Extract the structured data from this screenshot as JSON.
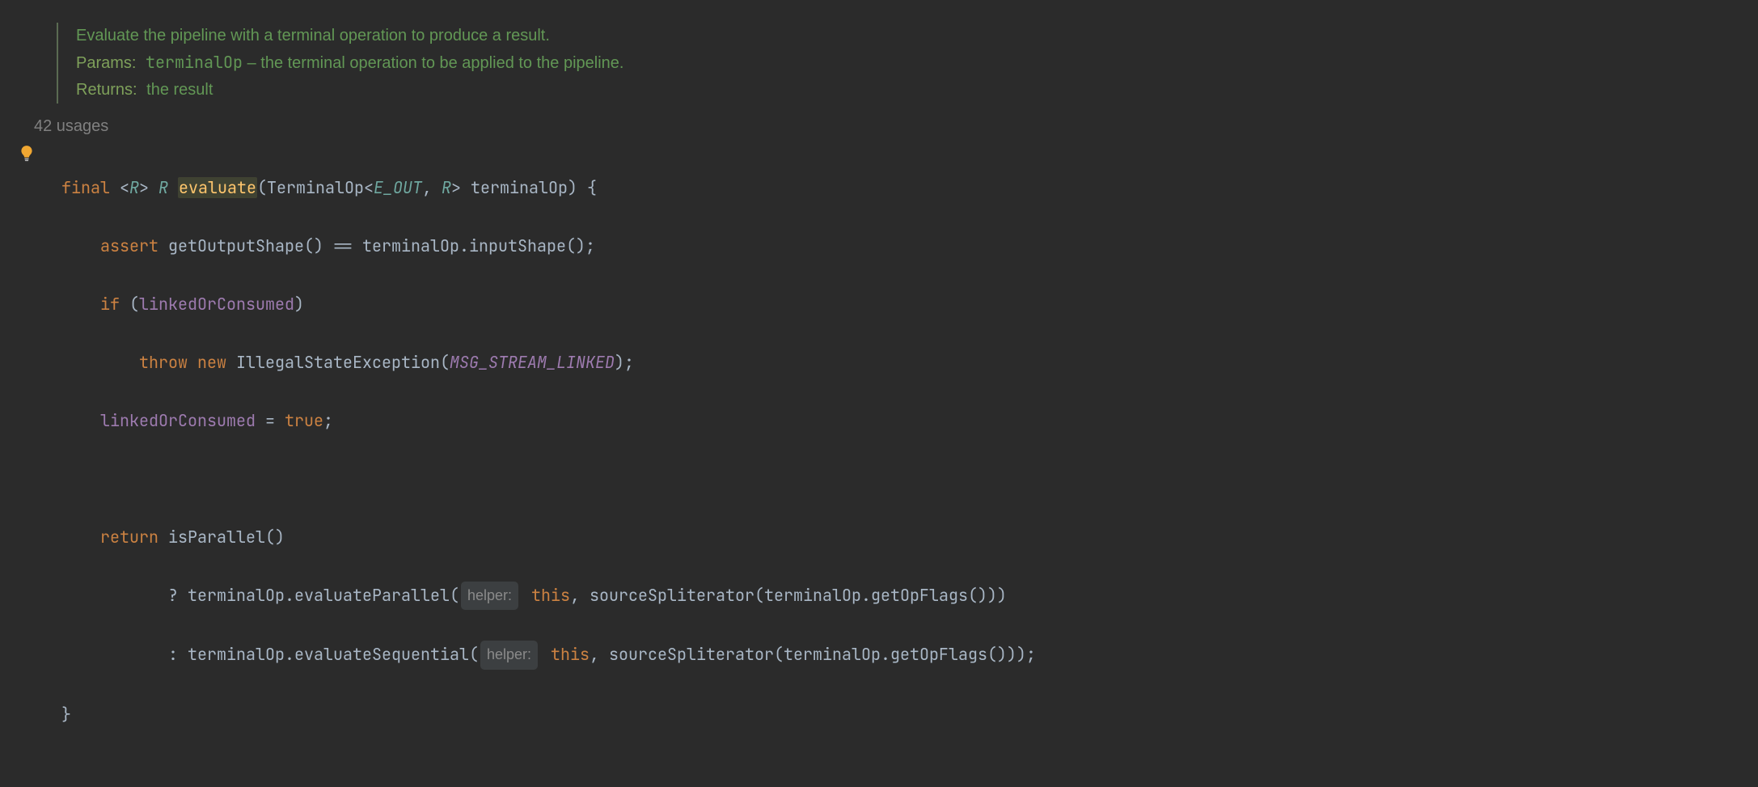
{
  "doc": {
    "summary": "Evaluate the pipeline with a terminal operation to produce a result.",
    "paramsLabel": "Params:",
    "paramName": "terminalOp",
    "paramDesc": " – the terminal operation to be applied to the pipeline.",
    "returnsLabel": "Returns:",
    "returnsDesc": "the result"
  },
  "usages": "42 usages",
  "hints": {
    "helper": "helper:"
  },
  "code": {
    "kw_final": "final",
    "kw_assert": "assert",
    "kw_if": "if",
    "kw_throw": "throw",
    "kw_new": "new",
    "kw_return": "return",
    "kw_true": "true",
    "kw_this1": "this",
    "kw_this2": "this",
    "gen_open": "<",
    "gen_R": "R",
    "gen_close": ">",
    "ret_R": "R",
    "method_evaluate": "evaluate",
    "type_TerminalOp": "TerminalOp",
    "lt": "<",
    "type_E_OUT": "E_OUT",
    "comma1": ", ",
    "type_R2": "R",
    "gt": ">",
    "param_terminalOp": "terminalOp",
    "brace_open": " {",
    "call_getOutputShape": "getOutputShape",
    "eqeq": " == ",
    "call_inputShape": "inputShape",
    "field_linkedOrConsumed": "linkedOrConsumed",
    "type_IllegalStateException": "IllegalStateException",
    "const_MSG": "MSG_STREAM_LINKED",
    "call_isParallel": "isParallel",
    "call_evaluateParallel": "evaluateParallel",
    "call_evaluateSequential": "evaluateSequential",
    "call_sourceSpliterator": "sourceSpliterator",
    "call_getOpFlags": "getOpFlags",
    "brace_close": "}",
    "semi": ";",
    "assign_true": " = ",
    "q": "? ",
    "colon": ": ",
    "dot": ".",
    "lpar": "(",
    "rpar": ")",
    "comma": ", "
  }
}
